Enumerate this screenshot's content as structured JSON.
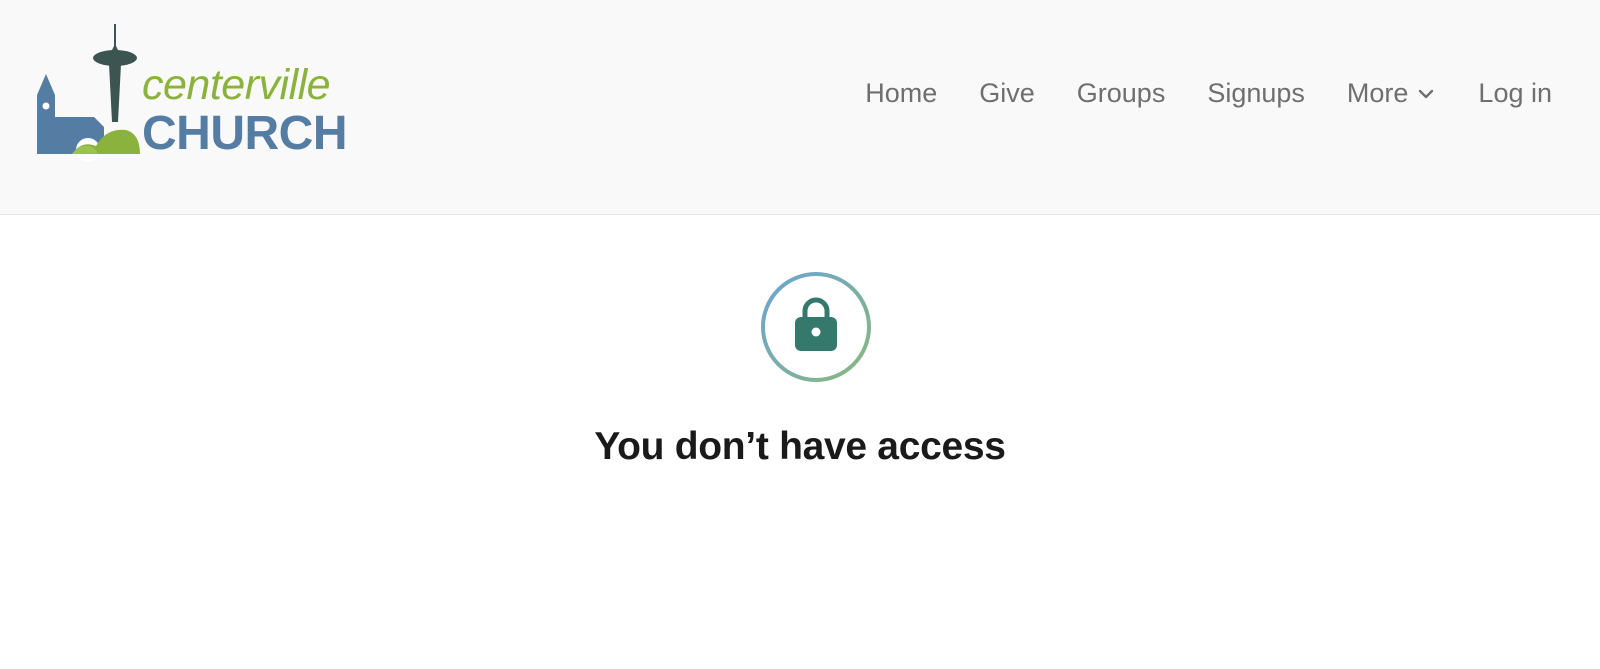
{
  "header": {
    "logo": {
      "line1": "centerville",
      "line2": "CHURCH",
      "colors": {
        "green": "#8bb23c",
        "blue": "#557da3",
        "dark": "#3d5550"
      }
    },
    "nav": {
      "items": [
        {
          "label": "Home"
        },
        {
          "label": "Give"
        },
        {
          "label": "Groups"
        },
        {
          "label": "Signups"
        },
        {
          "label": "More",
          "icon": "chevron-down-icon"
        },
        {
          "label": "Log in"
        }
      ]
    }
  },
  "main": {
    "icon": "lock-icon",
    "message": "You don’t have access",
    "colors": {
      "lock": "#35796d",
      "ring_start": "#6aa4d6",
      "ring_end": "#8ab87c"
    }
  }
}
